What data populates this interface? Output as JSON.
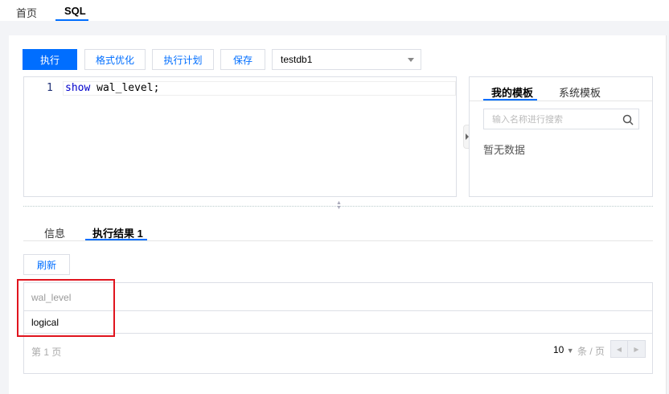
{
  "top_tabs": [
    {
      "label": "首页"
    },
    {
      "label": "SQL"
    }
  ],
  "toolbar": {
    "run": "执行",
    "format": "格式优化",
    "plan": "执行计划",
    "save": "保存",
    "database": "testdb1"
  },
  "editor": {
    "line_number": "1",
    "keyword": "show",
    "code_rest": " wal_level;"
  },
  "templates": {
    "tabs": [
      {
        "label": "我的模板"
      },
      {
        "label": "系统模板"
      }
    ],
    "search_placeholder": "输入名称进行搜索",
    "empty": "暂无数据"
  },
  "result_tabs": [
    {
      "label": "信息"
    },
    {
      "label": "执行结果 1"
    }
  ],
  "refresh": "刷新",
  "table": {
    "columns": [
      "wal_level"
    ],
    "rows": [
      [
        "logical"
      ]
    ]
  },
  "pager": {
    "page_text": "第 1 页",
    "page_size": "10",
    "per_page_label": "条 / 页"
  },
  "colors": {
    "accent": "#006eff",
    "highlight": "#e0141e"
  }
}
